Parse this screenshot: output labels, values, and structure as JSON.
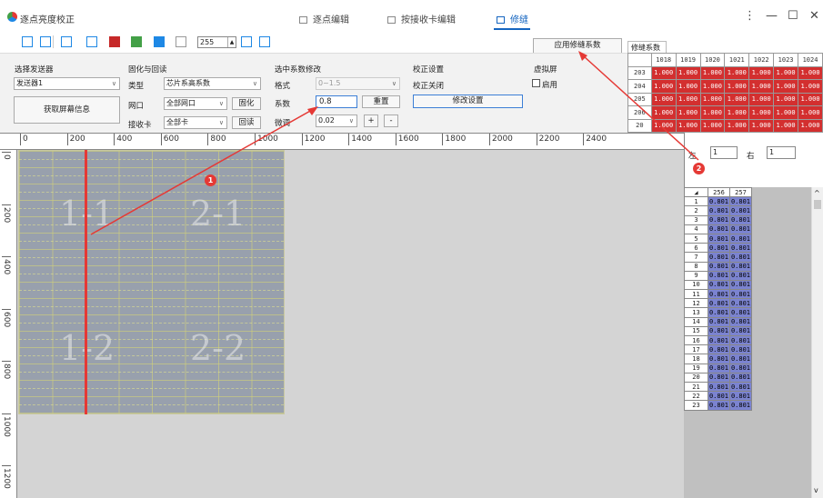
{
  "app": {
    "title": "逐点亮度校正",
    "menu_icon": "⋮",
    "min_icon": "—",
    "max_icon": "☐",
    "close_icon": "✕"
  },
  "tabs": [
    {
      "label": "逐点编辑"
    },
    {
      "label": "按接收卡编辑"
    },
    {
      "label": "修缝"
    }
  ],
  "toolbar": {
    "value": "255"
  },
  "apply_button": "应用修缝系数",
  "seam_coeff_title": "修缝系数",
  "coeff_table": {
    "columns": [
      "1018",
      "1019",
      "1020",
      "1021",
      "1022",
      "1023",
      "1024"
    ],
    "rows": [
      {
        "label": "203",
        "values": [
          "1.000",
          "1.000",
          "1.000",
          "1.000",
          "1.000",
          "1.000",
          "1.000"
        ]
      },
      {
        "label": "204",
        "values": [
          "1.000",
          "1.000",
          "1.000",
          "1.000",
          "1.000",
          "1.000",
          "1.000"
        ]
      },
      {
        "label": "205",
        "values": [
          "1.000",
          "1.000",
          "1.000",
          "1.000",
          "1.000",
          "1.000",
          "1.000"
        ]
      },
      {
        "label": "206",
        "values": [
          "1.000",
          "1.000",
          "1.000",
          "1.000",
          "1.000",
          "1.000",
          "1.000"
        ]
      },
      {
        "label": "20",
        "values": [
          "1.000",
          "1.000",
          "1.000",
          "1.000",
          "1.000",
          "1.000",
          "1.000"
        ]
      }
    ]
  },
  "sender": {
    "title": "选择发送器",
    "value": "发送器1",
    "fetch_button": "获取屏幕信息"
  },
  "solidify": {
    "title": "固化与回读",
    "type_label": "类型",
    "type_value": "芯片系高系数",
    "port_label": "网口",
    "port_value": "全部网口",
    "solidify_button": "固化",
    "card_label": "接收卡",
    "card_value": "全部卡",
    "readback_button": "回读"
  },
  "coeff_modify": {
    "title": "选中系数修改",
    "format_label": "格式",
    "format_value": "0~1.5",
    "coeff_label": "系数",
    "coeff_value": "0.8",
    "reset_button": "重置",
    "step_label": "微调",
    "step_value": "0.02",
    "plus": "+",
    "minus": "-"
  },
  "calib": {
    "title": "校正设置",
    "status": "校正关闭",
    "button": "修改设置"
  },
  "virtual": {
    "title": "虚拟屏",
    "enable": "启用"
  },
  "ruler_h": [
    "0",
    "200",
    "400",
    "600",
    "800",
    "1000",
    "1200",
    "1400",
    "1600",
    "1800",
    "2000",
    "2200",
    "2400"
  ],
  "ruler_v": [
    "0",
    "200",
    "400",
    "600",
    "800",
    "1000",
    "1200"
  ],
  "receivers": [
    "1-1",
    "2-1",
    "1-2",
    "2-2"
  ],
  "side": {
    "left_label": "左",
    "left_value": "1",
    "right_label": "右",
    "right_value": "1"
  },
  "table": {
    "columns": [
      "256",
      "257"
    ],
    "values": [
      "0.801",
      "0.801"
    ],
    "rows": [
      "1",
      "2",
      "3",
      "4",
      "5",
      "6",
      "7",
      "8",
      "9",
      "10",
      "11",
      "12",
      "13",
      "14",
      "15",
      "16",
      "17",
      "18",
      "19",
      "20",
      "21",
      "22",
      "23"
    ]
  },
  "markers": [
    "1",
    "2"
  ]
}
